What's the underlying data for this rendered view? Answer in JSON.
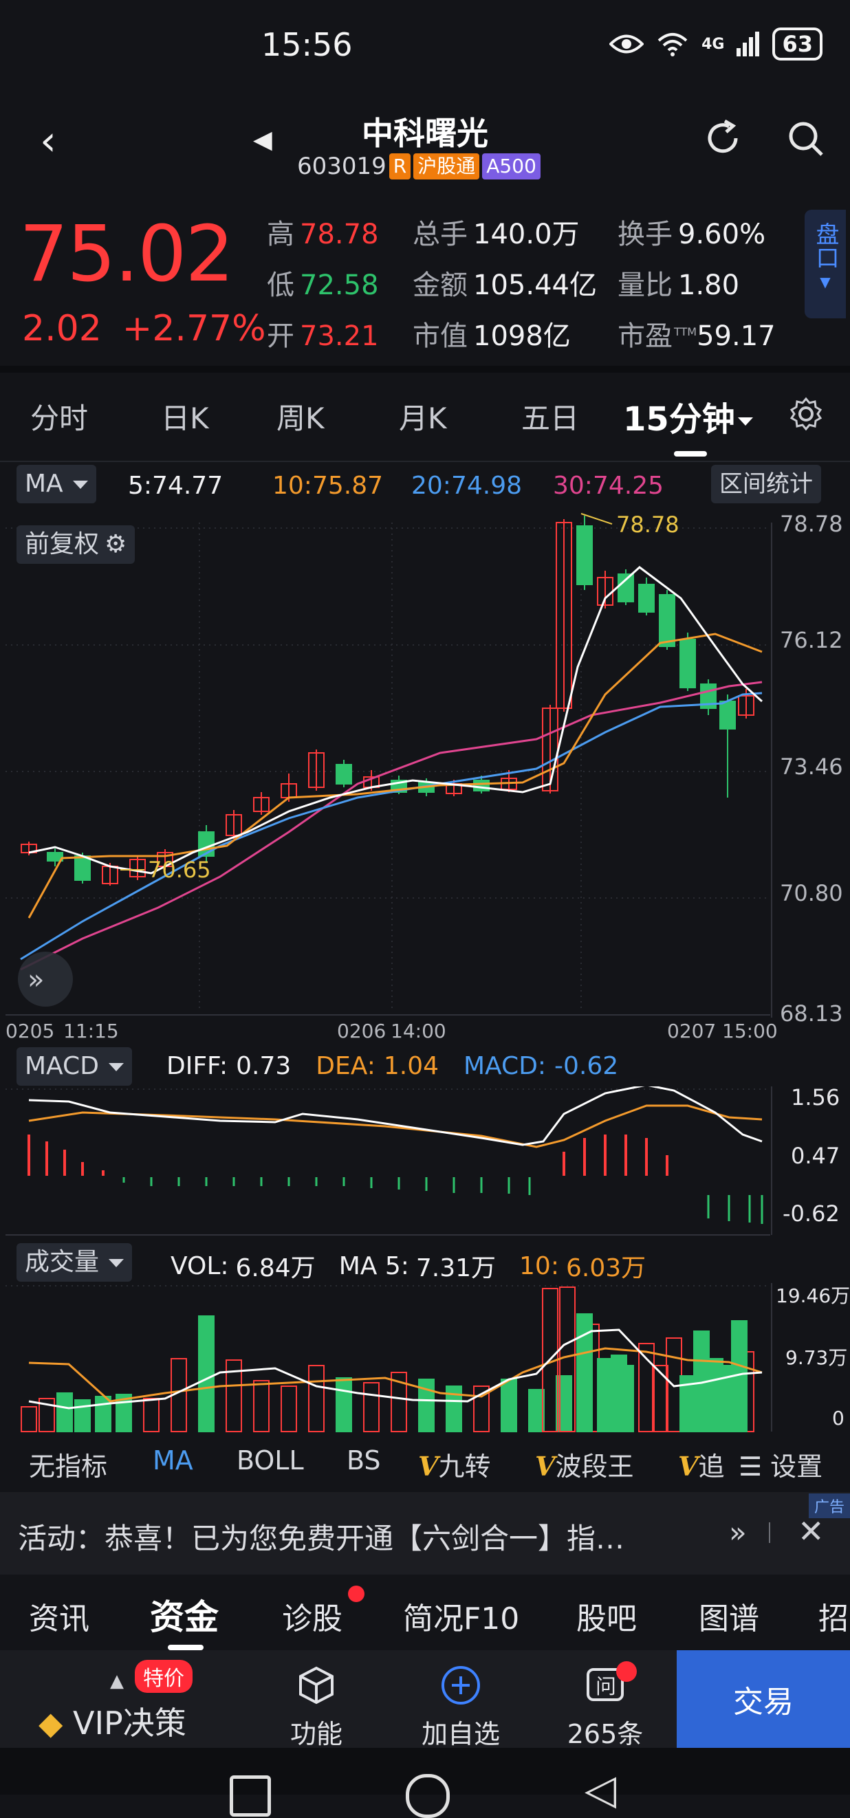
{
  "status_bar": {
    "time": "15:56",
    "network": "4G",
    "battery": "63"
  },
  "header": {
    "stock_name": "中科曙光",
    "stock_code": "603019",
    "badges": [
      {
        "text": "R",
        "color": "#f07c0c"
      },
      {
        "text": "沪股通",
        "color": "#f07c0c"
      },
      {
        "text": "A500",
        "color": "#7b5de3"
      }
    ]
  },
  "quote": {
    "price": "75.02",
    "change": "2.02",
    "change_pct": "+2.77%",
    "high_label": "高",
    "high": "78.78",
    "low_label": "低",
    "low": "72.58",
    "open_label": "开",
    "open": "73.21",
    "volume_label": "总手",
    "volume": "140.0万",
    "amount_label": "金额",
    "amount": "105.44亿",
    "mktcap_label": "市值",
    "mktcap": "1098亿",
    "turnover_label": "换手",
    "turnover": "9.60%",
    "vol_ratio_label": "量比",
    "vol_ratio": "1.80",
    "pe_label": "市盈",
    "pe_ttm_mark": "TTM",
    "pe": "59.17",
    "pankou": "盘口"
  },
  "period_tabs": [
    {
      "label": "分时"
    },
    {
      "label": "日K"
    },
    {
      "label": "周K"
    },
    {
      "label": "月K"
    },
    {
      "label": "五日"
    },
    {
      "label": "15分钟",
      "active": true
    }
  ],
  "ma_bar": {
    "selector": "MA",
    "ma5": "5:74.77",
    "ma10": "10:75.87",
    "ma20": "20:74.98",
    "ma30": "30:74.25",
    "range_stats": "区间统计",
    "adjust": "前复权"
  },
  "colors": {
    "up": "#ff3b3b",
    "down": "#2ec26b",
    "ma5": "#ffffff",
    "ma10": "#f39a2c",
    "ma20": "#4c9cf0",
    "ma30": "#e0458f"
  },
  "kline": {
    "y_ticks": [
      "78.78",
      "76.12",
      "73.46",
      "70.80",
      "68.13"
    ],
    "x_ticks": [
      "0205",
      "11:15",
      "0206",
      "14:00",
      "0207",
      "15:00"
    ],
    "high_mark": "78.78",
    "low_mark": "70.65"
  },
  "macd": {
    "selector": "MACD",
    "diff_label": "DIFF:",
    "diff": "0.73",
    "dea_label": "DEA:",
    "dea": "1.04",
    "macd_label": "MACD:",
    "macd": "-0.62",
    "y_ticks": [
      "1.56",
      "0.47",
      "-0.62"
    ]
  },
  "volume": {
    "selector": "成交量",
    "vol_label": "VOL:",
    "vol": "6.84万",
    "ma5_label": "MA 5:",
    "ma5": "7.31万",
    "ma10_label": "10:",
    "ma10": "6.03万",
    "y_ticks": [
      "19.46万",
      "9.73万",
      "0"
    ]
  },
  "indicator_tabs": [
    "无指标",
    "MA",
    "BOLL",
    "BS",
    "九转",
    "波段王",
    "追"
  ],
  "indicator_v": "V",
  "settings": "设置",
  "ad": {
    "tag": "广告",
    "text": "活动：恭喜！已为您免费开通【六剑合一】指…"
  },
  "info_tabs": [
    "资讯",
    "资金",
    "诊股",
    "简况F10",
    "股吧",
    "图谱",
    "招"
  ],
  "bottom_bar": {
    "vip": "VIP决策",
    "tejia": "特价",
    "func": "功能",
    "add": "加自选",
    "ask": "265条",
    "trade": "交易"
  }
}
